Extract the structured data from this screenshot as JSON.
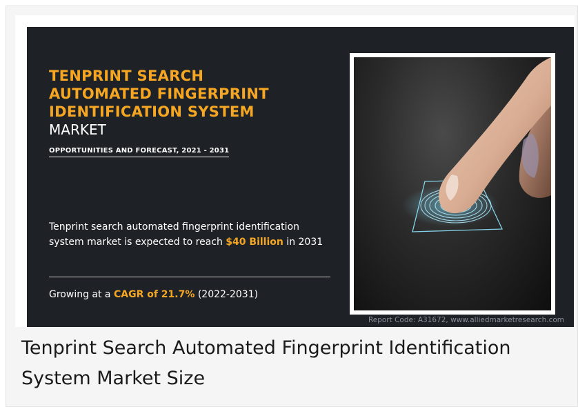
{
  "banner": {
    "title_lines": [
      "TENPRINT SEARCH",
      "AUTOMATED FINGERPRINT",
      "IDENTIFICATION SYSTEM"
    ],
    "title_market": "MARKET",
    "subtitle": "OPPORTUNITIES AND FORECAST, 2021 - 2031",
    "description_prefix": "Tenprint search automated fingerprint identification system market is expected to reach ",
    "description_value": "$40 Billion",
    "description_suffix": " in 2031",
    "cagr_prefix": "Growing at a ",
    "cagr_value": "CAGR of 21.7%",
    "cagr_suffix": " (2022-2031)",
    "report_code": "Report Code: A31672, www.alliedmarketresearch.com",
    "accent_color": "#f5a623",
    "background_color": "#1e2227",
    "photo_icon": "finger-touching-fingerprint-scanner"
  },
  "caption": "Tenprint Search Automated Fingerprint Identification System Market Size"
}
